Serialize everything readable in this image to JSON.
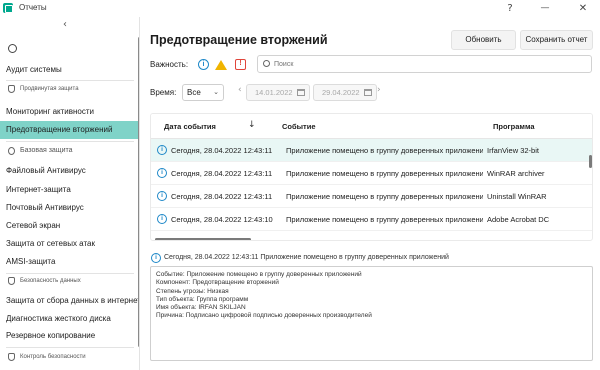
{
  "window": {
    "title": "Отчеты",
    "help_glyph": "?",
    "minimize_glyph": "—",
    "close_glyph": "✕"
  },
  "sidebar": {
    "collapse_glyph": "‹",
    "items": [
      {
        "label": "Аудит системы"
      },
      {
        "section": "Продвинутая защита"
      },
      {
        "label": "Мониторинг активности"
      },
      {
        "label": "Предотвращение вторжений",
        "active": true
      },
      {
        "section": "Базовая защита"
      },
      {
        "label": "Файловый Антивирус"
      },
      {
        "label": "Интернет-защита"
      },
      {
        "label": "Почтовый Антивирус"
      },
      {
        "label": "Сетевой экран"
      },
      {
        "label": "Защита от сетевых атак"
      },
      {
        "label": "AMSI-защита"
      },
      {
        "section": "Безопасность данных"
      },
      {
        "label": "Защита от сбора данных в интернете"
      },
      {
        "label": "Диагностика жесткого диска"
      },
      {
        "label": "Резервное копирование"
      },
      {
        "section": "Контроль безопасности"
      }
    ]
  },
  "main": {
    "title": "Предотвращение вторжений",
    "refresh_button": "Обновить",
    "save_button": "Сохранить отчет",
    "severity_label": "Важность:",
    "search_placeholder": "Поиск",
    "time_label": "Время:",
    "time_select": "Все",
    "date_from": "14.01.2022",
    "date_to": "29.04.2022",
    "prev_glyph": "‹",
    "next_glyph": "›"
  },
  "table": {
    "columns": [
      "Дата события",
      "Событие",
      "Программа"
    ],
    "sort_glyph": "↓",
    "rows": [
      {
        "date": "Сегодня, 28.04.2022 12:43:11",
        "event": "Приложение помещено в группу доверенных приложений",
        "program": "IrfanView 32-bit"
      },
      {
        "date": "Сегодня, 28.04.2022 12:43:11",
        "event": "Приложение помещено в группу доверенных приложений",
        "program": "WinRAR archiver"
      },
      {
        "date": "Сегодня, 28.04.2022 12:43:11",
        "event": "Приложение помещено в группу доверенных приложений",
        "program": "Uninstall WinRAR"
      },
      {
        "date": "Сегодня, 28.04.2022 12:43:10",
        "event": "Приложение помещено в группу доверенных приложений",
        "program": "Adobe Acrobat DC"
      }
    ]
  },
  "details": {
    "header": "Сегодня, 28.04.2022 12:43:11 Приложение помещено в группу доверенных приложений",
    "lines": [
      "Событие: Приложение помещено в группу доверенных приложений",
      "Компонент: Предотвращение вторжений",
      "Степень угрозы: Низкая",
      "Тип объекта: Группа программ",
      "Имя объекта: IRFAN SKILJAN",
      "Причина: Подписано цифровой подписью доверенных производителей"
    ]
  },
  "colors": {
    "accent": "#00a88e",
    "active_item": "#7fd3c8",
    "info": "#1e88c8",
    "warning": "#f0b400",
    "critical": "#e0453b"
  }
}
